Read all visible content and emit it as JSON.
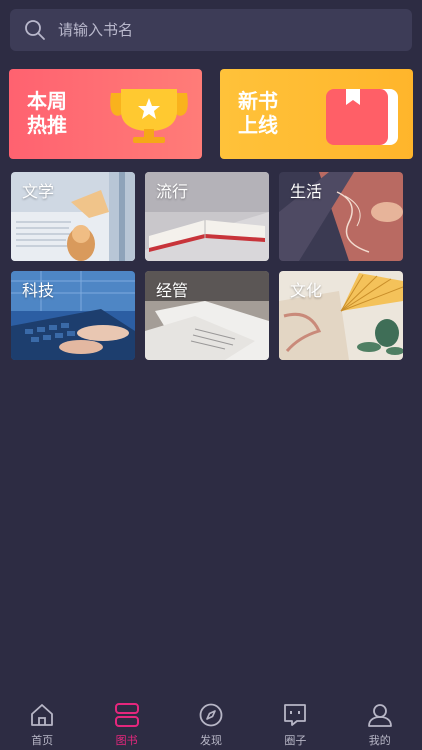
{
  "search": {
    "placeholder": "请输入书名"
  },
  "banners": [
    {
      "line1": "本周",
      "line2": "热推",
      "icon": "trophy-icon",
      "color": "#ff6a72"
    },
    {
      "line1": "新书",
      "line2": "上线",
      "icon": "book-icon",
      "color": "#ffbd33"
    }
  ],
  "categories": [
    {
      "label": "文学"
    },
    {
      "label": "流行"
    },
    {
      "label": "生活"
    },
    {
      "label": "科技"
    },
    {
      "label": "经管"
    },
    {
      "label": "文化"
    }
  ],
  "tabbar": {
    "items": [
      {
        "label": "首页",
        "icon": "home-icon",
        "active": false
      },
      {
        "label": "图书",
        "icon": "books-icon",
        "active": true
      },
      {
        "label": "发现",
        "icon": "compass-icon",
        "active": false
      },
      {
        "label": "圈子",
        "icon": "chat-icon",
        "active": false
      },
      {
        "label": "我的",
        "icon": "user-icon",
        "active": false
      }
    ],
    "active_color": "#e6277d",
    "inactive_color": "#b7b6c6"
  }
}
